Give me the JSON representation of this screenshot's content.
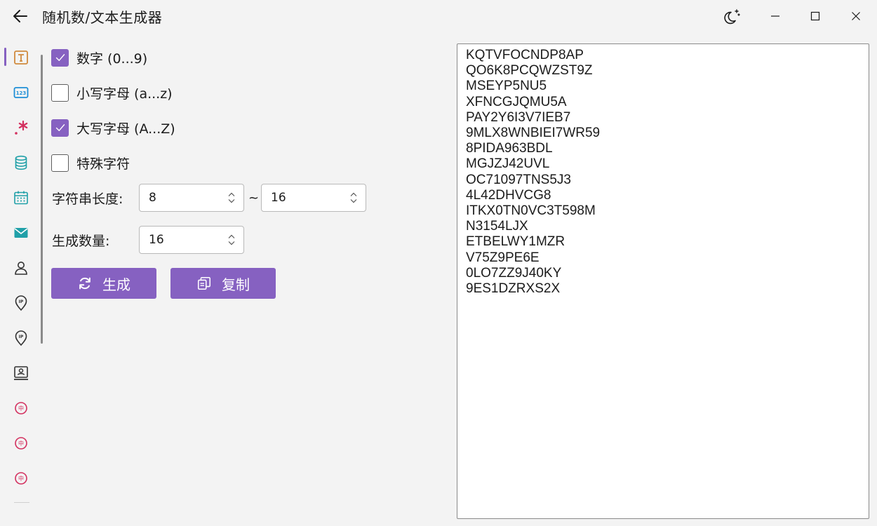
{
  "window": {
    "title": "随机数/文本生成器",
    "controls": [
      "back",
      "theme",
      "minimize",
      "maximize",
      "close"
    ]
  },
  "sidebar": {
    "items": [
      {
        "icon": "text-generator-icon",
        "selected": true,
        "color": "#d08a3e"
      },
      {
        "icon": "number-123-icon",
        "selected": false,
        "color": "#1f8fd6"
      },
      {
        "icon": "regex-icon",
        "selected": false,
        "color": "#d3305f"
      },
      {
        "icon": "database-icon",
        "selected": false,
        "color": "#20a0a8"
      },
      {
        "icon": "calendar-icon",
        "selected": false,
        "color": "#20a0a8"
      },
      {
        "icon": "mail-icon",
        "selected": false,
        "color": "#20a0a8"
      },
      {
        "icon": "user-icon",
        "selected": false,
        "color": "#333333"
      },
      {
        "icon": "ip-location-icon",
        "selected": false,
        "color": "#333333"
      },
      {
        "icon": "ip-location-icon",
        "selected": false,
        "color": "#333333"
      },
      {
        "icon": "id-card-icon",
        "selected": false,
        "color": "#333333"
      },
      {
        "icon": "china-badge-icon",
        "selected": false,
        "color": "#d3305f"
      },
      {
        "icon": "china-badge-icon",
        "selected": false,
        "color": "#d3305f"
      },
      {
        "icon": "china-badge-icon",
        "selected": false,
        "color": "#d3305f"
      }
    ]
  },
  "options": {
    "digits": {
      "label": "数字 (0...9)",
      "checked": true
    },
    "lowercase": {
      "label": "小写字母 (a...z)",
      "checked": false
    },
    "uppercase": {
      "label": "大写字母 (A...Z)",
      "checked": true
    },
    "special": {
      "label": "特殊字符",
      "checked": false
    },
    "length": {
      "label": "字符串长度:",
      "min": "8",
      "separator": "~",
      "max": "16"
    },
    "count": {
      "label": "生成数量:",
      "value": "16"
    }
  },
  "actions": {
    "generate_label": "生成",
    "copy_label": "复制"
  },
  "output": {
    "lines": [
      "KQTVFOCNDP8AP",
      "QO6K8PCQWZST9Z",
      "MSEYP5NU5",
      "XFNCGJQMU5A",
      "PAY2Y6I3V7IEB7",
      "9MLX8WNBIEI7WR59",
      "8PIDA963BDL",
      "MGJZJ42UVL",
      "OC71097TNS5J3",
      "4L42DHVCG8",
      "ITKX0TN0VC3T598M",
      "N3154LJX",
      "ETBELWY1MZR",
      "V75Z9PE6E",
      "0LO7ZZ9J40KY",
      "9ES1DZRXS2X"
    ]
  },
  "colors": {
    "accent": "#8661c1",
    "background": "#f3f3f3"
  }
}
